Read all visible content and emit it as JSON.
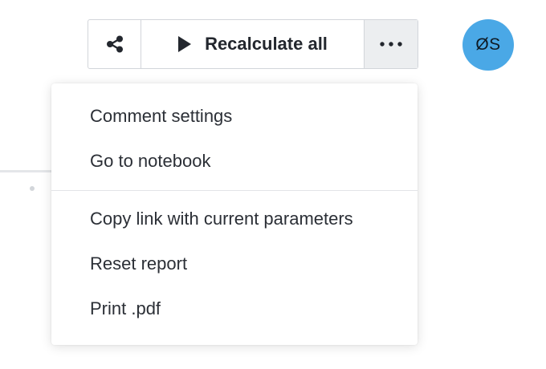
{
  "toolbar": {
    "share_icon": "share-icon",
    "recalculate_label": "Recalculate all",
    "recalculate_icon": "play-icon",
    "more_icon": "ellipsis-icon"
  },
  "user": {
    "initials": "ØS",
    "avatar_color": "#4aa8e6"
  },
  "menu": {
    "group1": [
      {
        "label": "Comment settings"
      },
      {
        "label": "Go to notebook"
      }
    ],
    "group2": [
      {
        "label": "Copy link with current parameters"
      },
      {
        "label": "Reset report"
      },
      {
        "label": "Print .pdf"
      }
    ]
  }
}
